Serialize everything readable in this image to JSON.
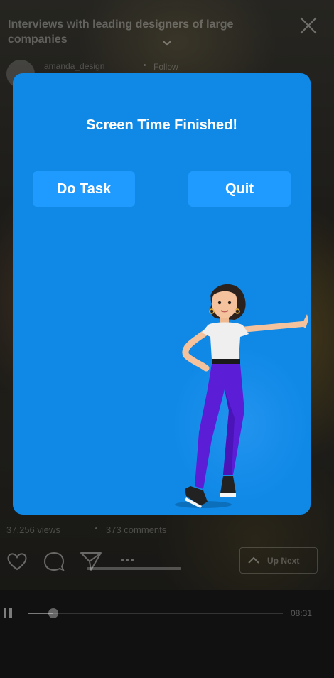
{
  "video": {
    "title": "Interviews with leading designers of large companies",
    "username": "amanda_design",
    "follow_label": "Follow"
  },
  "modal": {
    "title": "Screen Time Finished!",
    "do_task_label": "Do Task",
    "quit_label": "Quit",
    "background_color": "#0f88e6",
    "button_color": "#1f9bff"
  },
  "stats": {
    "views": "37,256 views",
    "comments": "373 comments"
  },
  "actions": {
    "icons": [
      "heart-icon",
      "comment-icon",
      "send-icon",
      "more-icon"
    ],
    "up_next_label": "Up Next"
  },
  "player": {
    "time": "08:31",
    "progress": 0.1
  }
}
